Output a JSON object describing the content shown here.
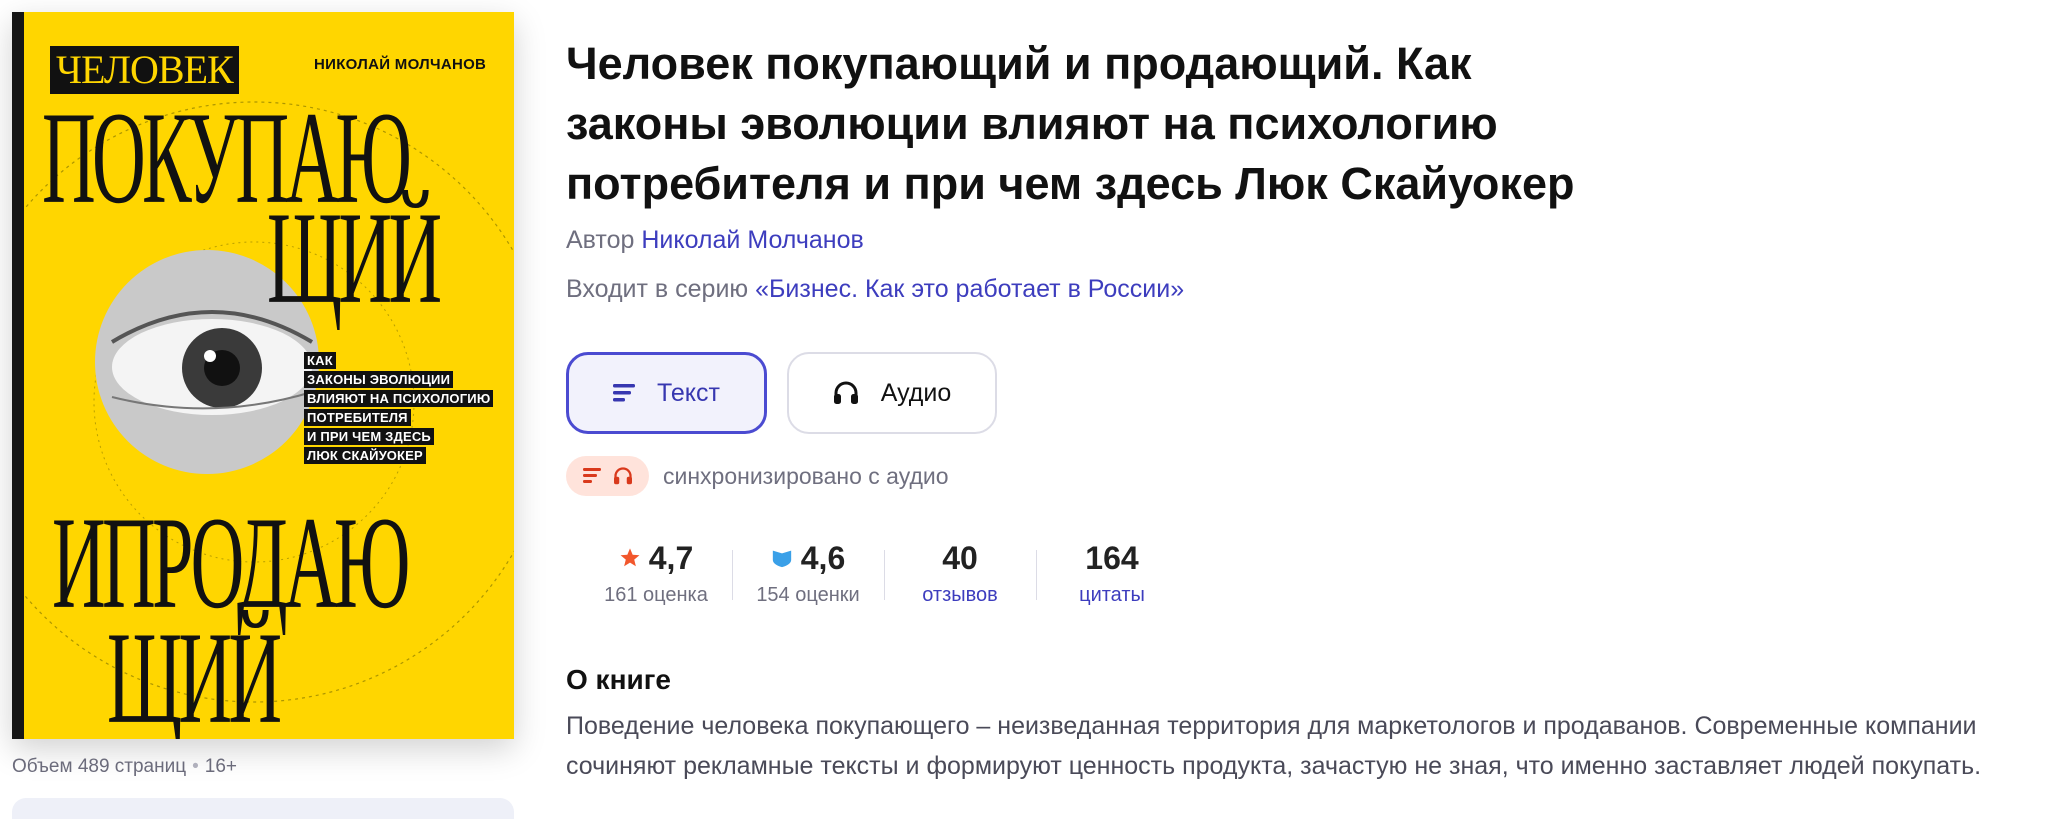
{
  "cover": {
    "author": "НИКОЛАЙ МОЛЧАНОВ",
    "title_line1": "ЧЕЛОВЕК",
    "title_word2": "ПОКУПАЮ",
    "title_word3": "ЩИЙ",
    "title_word4": "ПРОДАЮ",
    "title_word5": "ЩИЙ",
    "title_and": "И",
    "subtitle_lines": [
      "КАК",
      "ЗАКОНЫ ЭВОЛЮЦИИ",
      "ВЛИЯЮТ НА ПСИХОЛОГИЮ",
      "ПОТРЕБИТЕЛЯ",
      "И ПРИ ЧЕМ ЗДЕСЬ",
      "ЛЮК СКАЙУОКЕР"
    ]
  },
  "meta": {
    "pages": "Объем 489 страниц",
    "age": "16+"
  },
  "book": {
    "title": "Человек покупающий и продающий. Как законы эволюции влияют на психологию потребителя и при чем здесь Люк Скайуокер",
    "author_label": "Автор",
    "author_name": "Николай Молчанов",
    "series_label": "Входит в серию",
    "series_name": "«Бизнес. Как это работает в России»"
  },
  "formats": {
    "text_label": "Текст",
    "audio_label": "Аудио"
  },
  "sync_text": "синхронизировано с аудио",
  "stats": {
    "rating1_value": "4,7",
    "rating1_label": "161 оценка",
    "rating2_value": "4,6",
    "rating2_label": "154 оценки",
    "reviews_value": "40",
    "reviews_label": "отзывов",
    "quotes_value": "164",
    "quotes_label": "цитаты"
  },
  "about": {
    "heading": "О книге",
    "text": "Поведение человека покупающего – неизведанная территория для маркетологов и продаванов. Современные компании сочиняют рекламные тексты и формируют ценность продукта, зачастую не зная, что именно заставляет людей покупать."
  },
  "colors": {
    "accent": "#3d3dbe",
    "cover_yellow": "#ffd600",
    "star": "#f2572c",
    "badge_bg": "#ffe3db"
  }
}
